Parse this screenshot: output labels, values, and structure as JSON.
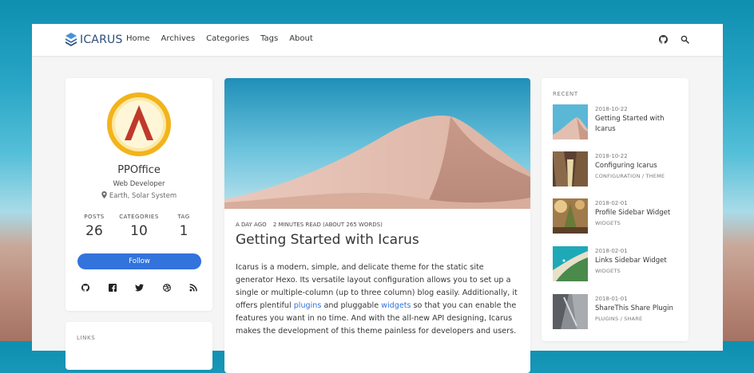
{
  "navbar": {
    "logo_text": "ICARUS",
    "links": [
      "Home",
      "Archives",
      "Categories",
      "Tags",
      "About"
    ],
    "icons": [
      "github-icon",
      "search-icon"
    ]
  },
  "profile": {
    "name": "PPOffice",
    "title": "Web Developer",
    "location": "Earth, Solar System",
    "stats": [
      {
        "label": "POSTS",
        "value": "26"
      },
      {
        "label": "CATEGORIES",
        "value": "10"
      },
      {
        "label": "TAG",
        "value": "1"
      }
    ],
    "follow_label": "Follow",
    "social_icons": [
      "github-icon",
      "facebook-icon",
      "twitter-icon",
      "dribbble-icon",
      "rss-icon"
    ]
  },
  "links_widget": {
    "label": "LINKS"
  },
  "post": {
    "meta_date": "A DAY AGO",
    "meta_read": "2 MINUTES READ (ABOUT 265 WORDS)",
    "title": "Getting Started with Icarus",
    "body_1": "Icarus is a modern, simple, and delicate theme for the static site generator Hexo. Its versatile layout configuration allows you to set up a single or multiple-column (up to three column) blog easily. Additionally, it offers plentiful ",
    "link_1": "plugins",
    "body_2": " and pluggable ",
    "link_2": "widgets",
    "body_3": " so that you can enable the features you want in no time. And with the all-new API designing, Icarus makes the development of this theme painless for developers and users."
  },
  "recent": {
    "label": "RECENT",
    "items": [
      {
        "date": "2018-10-22",
        "title": "Getting Started with Icarus",
        "category": ""
      },
      {
        "date": "2018-10-22",
        "title": "Configuring Icarus",
        "category": "CONFIGURATION / THEME"
      },
      {
        "date": "2018-02-01",
        "title": "Profile Sidebar Widget",
        "category": "WIDGETS"
      },
      {
        "date": "2018-02-01",
        "title": "Links Sidebar Widget",
        "category": "WIDGETS"
      },
      {
        "date": "2018-01-01",
        "title": "ShareThis Share Plugin",
        "category": "PLUGINS / SHARE"
      }
    ]
  },
  "colors": {
    "accent": "#3273dc",
    "logo_blue": "#2d4d7b",
    "avatar_ring": "#f3b31a",
    "avatar_inner": "#c0392b"
  }
}
